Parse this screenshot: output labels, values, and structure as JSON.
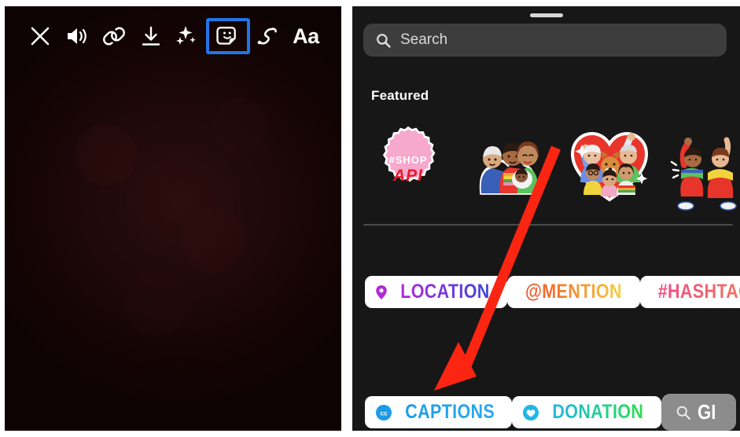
{
  "left_panel": {
    "name": "story-composer-preview",
    "background_color": "#1a0606",
    "toolbar": {
      "items": [
        {
          "icon": "close-icon",
          "label": "Close"
        },
        {
          "icon": "volume-icon",
          "label": "Sound"
        },
        {
          "icon": "link-icon",
          "label": "Link"
        },
        {
          "icon": "download-icon",
          "label": "Save"
        },
        {
          "icon": "sparkles-icon",
          "label": "Effects"
        },
        {
          "icon": "sticker-icon",
          "label": "Stickers",
          "selected": true
        },
        {
          "icon": "draw-icon",
          "label": "Draw"
        },
        {
          "icon": "text-icon",
          "label": "Aa"
        }
      ],
      "selected_highlight_color": "#2275e8"
    }
  },
  "right_panel": {
    "name": "sticker-tray",
    "background_color": "#171717",
    "search": {
      "placeholder": "Search",
      "value": "",
      "icon": "search-icon"
    },
    "featured": {
      "title": "Featured",
      "stickers": [
        {
          "name": "shop-api-badge-sticker",
          "caption_top": "#SHOP",
          "caption_bottom": "API",
          "color": "#f2a0c4"
        },
        {
          "name": "family-group-sticker"
        },
        {
          "name": "heart-family-sticker"
        },
        {
          "name": "dancers-sticker"
        }
      ]
    },
    "chips_row_1": [
      {
        "id": "location",
        "label": "LOCATION",
        "icon": "location-pin-icon",
        "gradient_from": "#b02ad8",
        "gradient_to": "#2940d8",
        "icon_color": "#b02ad8"
      },
      {
        "id": "mention",
        "label": "@MENTION",
        "icon": "at-symbol-icon",
        "gradient_from": "#f05a28",
        "gradient_to": "#f5c842",
        "icon_color": "#f05a28"
      },
      {
        "id": "hashtag",
        "label": "#HASHTAG",
        "icon": "",
        "gradient_from": "#ef5a7a",
        "gradient_to": "#f3765f",
        "icon_color": "#ef5a7a"
      }
    ],
    "chips_row_2": [
      {
        "id": "captions",
        "label": "CAPTIONS",
        "icon": "cc-icon",
        "gradient_from": "#1c9ce8",
        "gradient_to": "#2aa8f0",
        "icon_color": "#1c9ce8"
      },
      {
        "id": "donation",
        "label": "DONATION",
        "icon": "heart-circle-icon",
        "gradient_from": "#22b6e8",
        "gradient_to": "#2ae05a",
        "icon_color": "#22b6e8"
      }
    ],
    "gif_chip": {
      "id": "gif",
      "label": "GI",
      "icon": "search-icon",
      "background_color": "#8c8c8c"
    }
  },
  "annotation": {
    "arrow": {
      "name": "red-arrow-annotation",
      "color": "#fb2512",
      "points_to": "captions"
    }
  }
}
